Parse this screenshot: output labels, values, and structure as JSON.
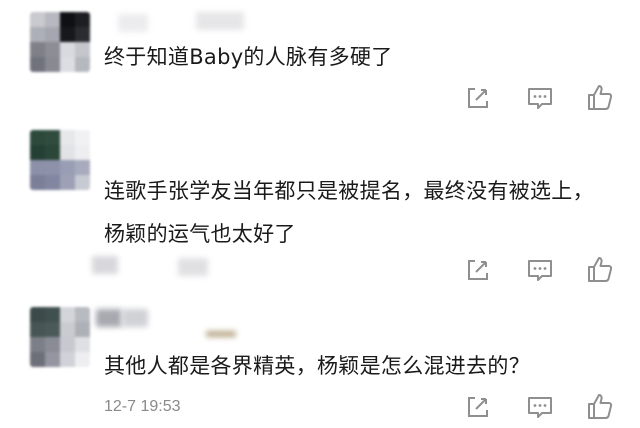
{
  "comments": [
    {
      "text": "终于知道Baby的人脉有多硬了",
      "time": ""
    },
    {
      "text": "连歌手张学友当年都只是被提名，最终没有被选上，杨颖的运气也太好了",
      "time": ""
    },
    {
      "text": "其他人都是各界精英，杨颖是怎么混进去的？",
      "time": "12-7 19:53"
    }
  ],
  "icons": {
    "edit": "edit-icon",
    "reply": "comment-icon",
    "like": "thumbs-up-icon"
  },
  "colors": {
    "text": "#1a1a1a",
    "time": "#8a8a8a",
    "icon": "#8f8f8f"
  }
}
